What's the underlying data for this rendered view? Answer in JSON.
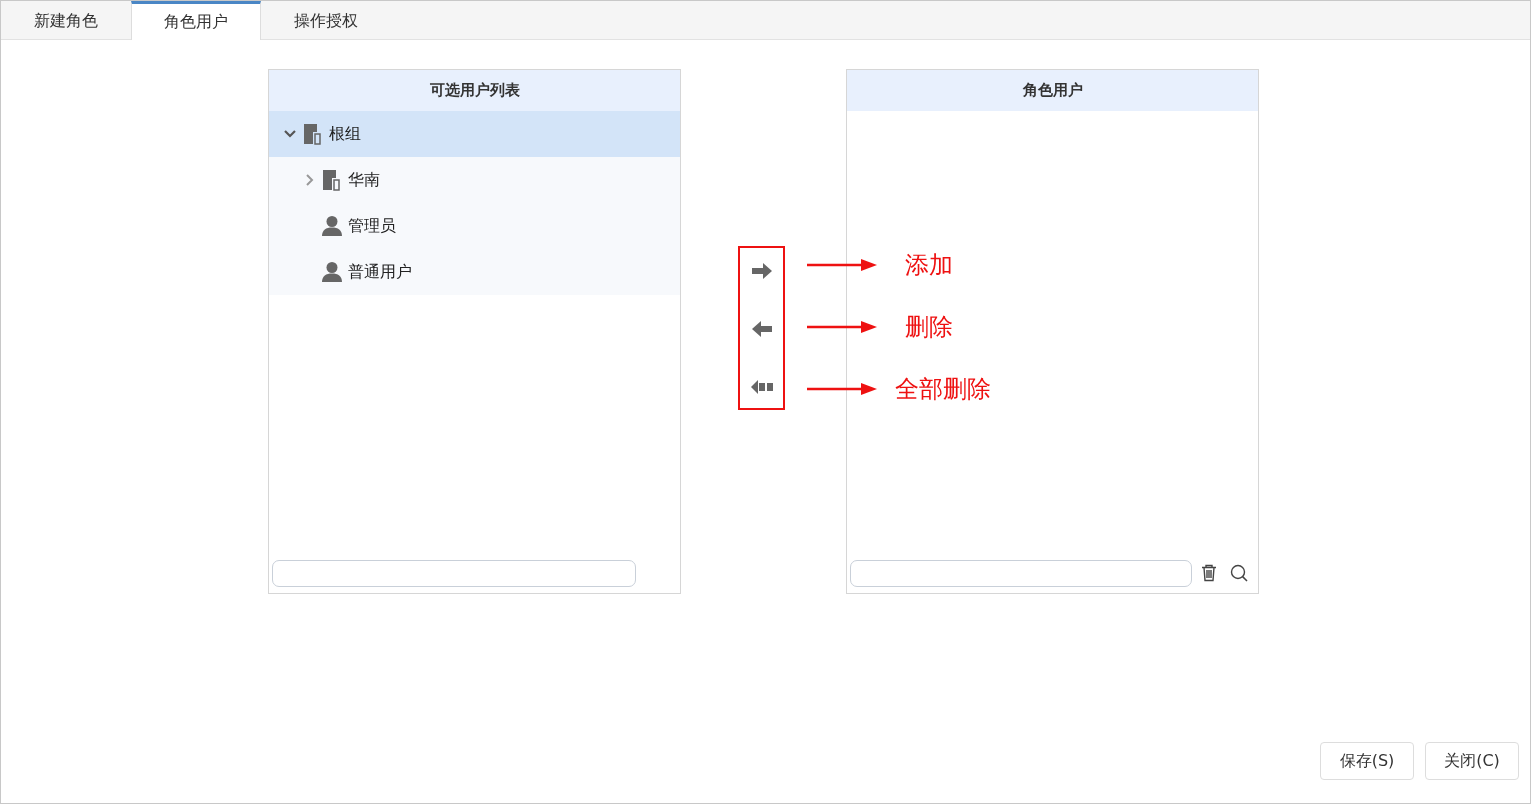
{
  "tabs": [
    {
      "label": "新建角色",
      "selected": false
    },
    {
      "label": "角色用户",
      "selected": true
    },
    {
      "label": "操作授权",
      "selected": false
    }
  ],
  "available_panel": {
    "title": "可选用户列表",
    "tree": [
      {
        "kind": "group",
        "label": "根组",
        "expanded": true,
        "selected": true,
        "children": [
          {
            "kind": "group",
            "label": "华南",
            "expanded": false,
            "selected": false
          },
          {
            "kind": "user",
            "label": "管理员",
            "selected": false
          },
          {
            "kind": "user",
            "label": "普通用户",
            "selected": false
          }
        ]
      }
    ]
  },
  "transfer_buttons": [
    {
      "kind": "add"
    },
    {
      "kind": "remove"
    },
    {
      "kind": "remove_all"
    }
  ],
  "annotations": [
    {
      "label": "添加"
    },
    {
      "label": "删除"
    },
    {
      "label": "全部删除"
    }
  ],
  "role_panel": {
    "title": "角色用户"
  },
  "buttons": [
    "保存(S)",
    "关闭(C)"
  ]
}
